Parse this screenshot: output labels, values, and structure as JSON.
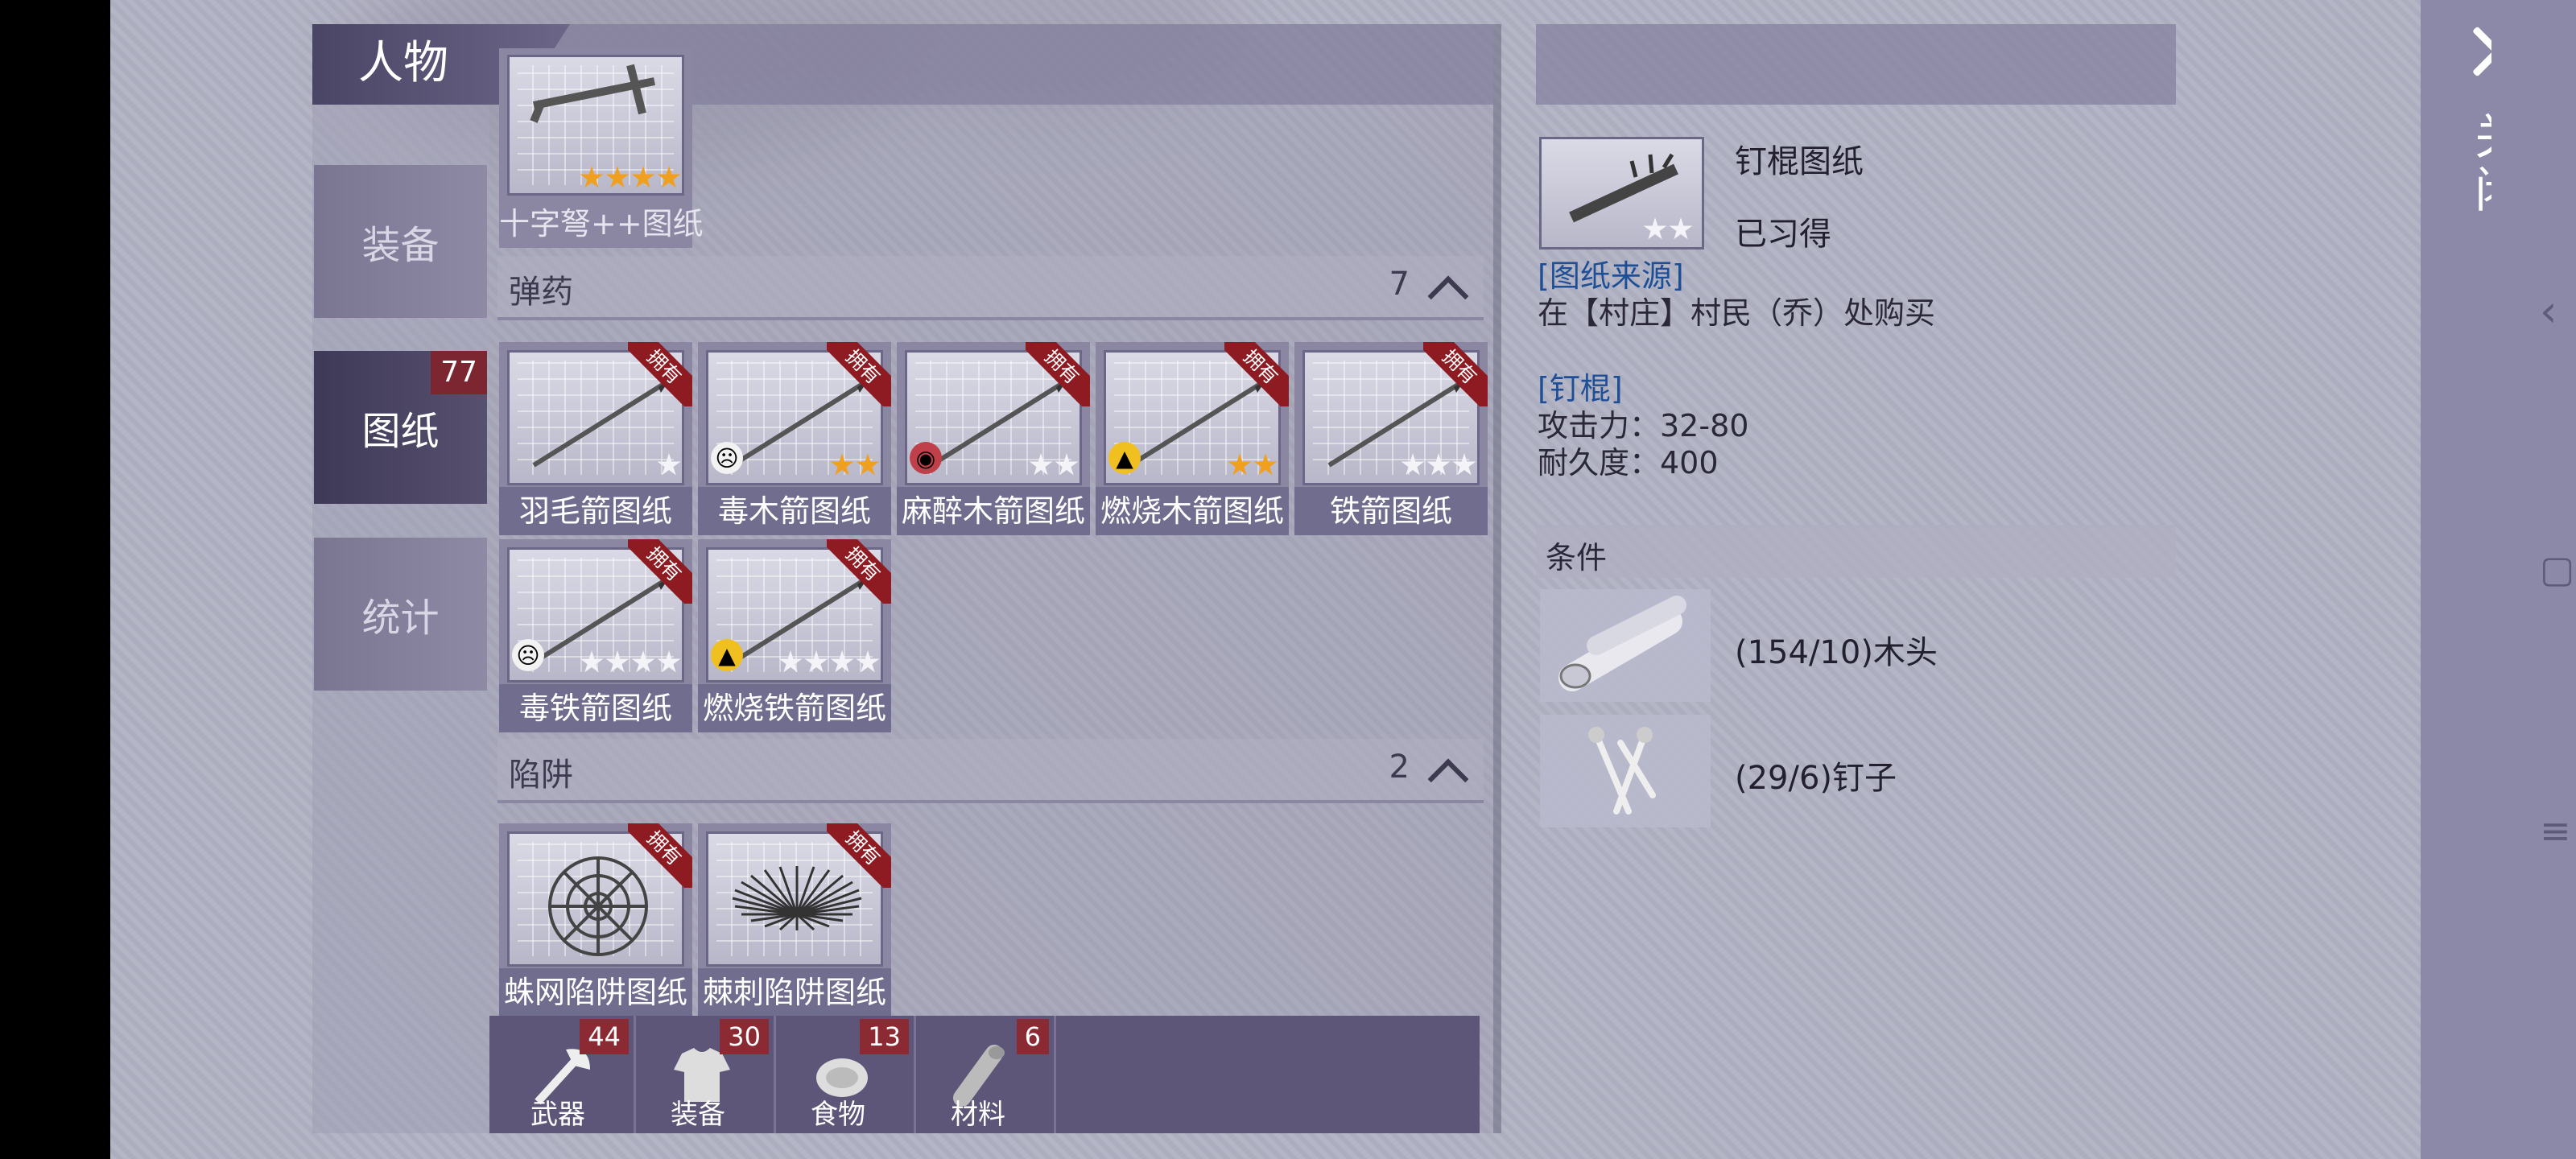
{
  "window": {
    "title": "人物",
    "close_label": "关闭"
  },
  "tabs": [
    {
      "label": "装备",
      "active": false
    },
    {
      "label": "图纸",
      "active": true,
      "badge": "77"
    },
    {
      "label": "统计",
      "active": false
    }
  ],
  "partial_item": {
    "label": "十字弩++图纸",
    "stars_gold": 4,
    "stars_white": 0
  },
  "sections": [
    {
      "title": "弹药",
      "count": "7",
      "items": [
        {
          "label": "羽毛箭图纸",
          "owned_tag": "拥有",
          "stars_gold": 0,
          "stars_white": 1,
          "effect": ""
        },
        {
          "label": "毒木箭图纸",
          "owned_tag": "拥有",
          "stars_gold": 2,
          "stars_white": 0,
          "effect": "poison"
        },
        {
          "label": "麻醉木箭图纸",
          "owned_tag": "拥有",
          "stars_gold": 0,
          "stars_white": 2,
          "effect": "anesthetic"
        },
        {
          "label": "燃烧木箭图纸",
          "owned_tag": "拥有",
          "stars_gold": 2,
          "stars_white": 0,
          "effect": "fire"
        },
        {
          "label": "铁箭图纸",
          "owned_tag": "拥有",
          "stars_gold": 0,
          "stars_white": 3,
          "effect": ""
        },
        {
          "label": "毒铁箭图纸",
          "owned_tag": "拥有",
          "stars_gold": 0,
          "stars_white": 4,
          "effect": "poison"
        },
        {
          "label": "燃烧铁箭图纸",
          "owned_tag": "拥有",
          "stars_gold": 0,
          "stars_white": 4,
          "effect": "fire"
        }
      ]
    },
    {
      "title": "陷阱",
      "count": "2",
      "items": [
        {
          "label": "蛛网陷阱图纸",
          "owned_tag": "拥有",
          "stars_gold": 0,
          "stars_white": 0,
          "effect": ""
        },
        {
          "label": "棘刺陷阱图纸",
          "owned_tag": "拥有",
          "stars_gold": 0,
          "stars_white": 0,
          "effect": ""
        }
      ]
    }
  ],
  "categories": [
    {
      "label": "武器",
      "count": "44",
      "icon": "axe-icon"
    },
    {
      "label": "装备",
      "count": "30",
      "icon": "shirt-icon"
    },
    {
      "label": "食物",
      "count": "13",
      "icon": "meat-icon"
    },
    {
      "label": "材料",
      "count": "6",
      "icon": "wood-icon"
    }
  ],
  "detail": {
    "name": "钉棍图纸",
    "status": "已习得",
    "stars_white": 2,
    "source_heading": "[图纸来源]",
    "source_text": "在【村庄】村民（乔）处购买",
    "item_heading": "[钉棍]",
    "attack": "攻击力：32-80",
    "durability": "耐久度：400",
    "conditions_title": "条件",
    "materials": [
      {
        "text": "(154/10)木头",
        "icon": "wood-log-icon"
      },
      {
        "text": "(29/6)钉子",
        "icon": "nails-icon"
      }
    ]
  },
  "colors": {
    "owned_ribbon": "#8e1b22",
    "badge": "#7b2630",
    "link_blue": "#1e4f96",
    "gold_star": "#f0a020"
  }
}
